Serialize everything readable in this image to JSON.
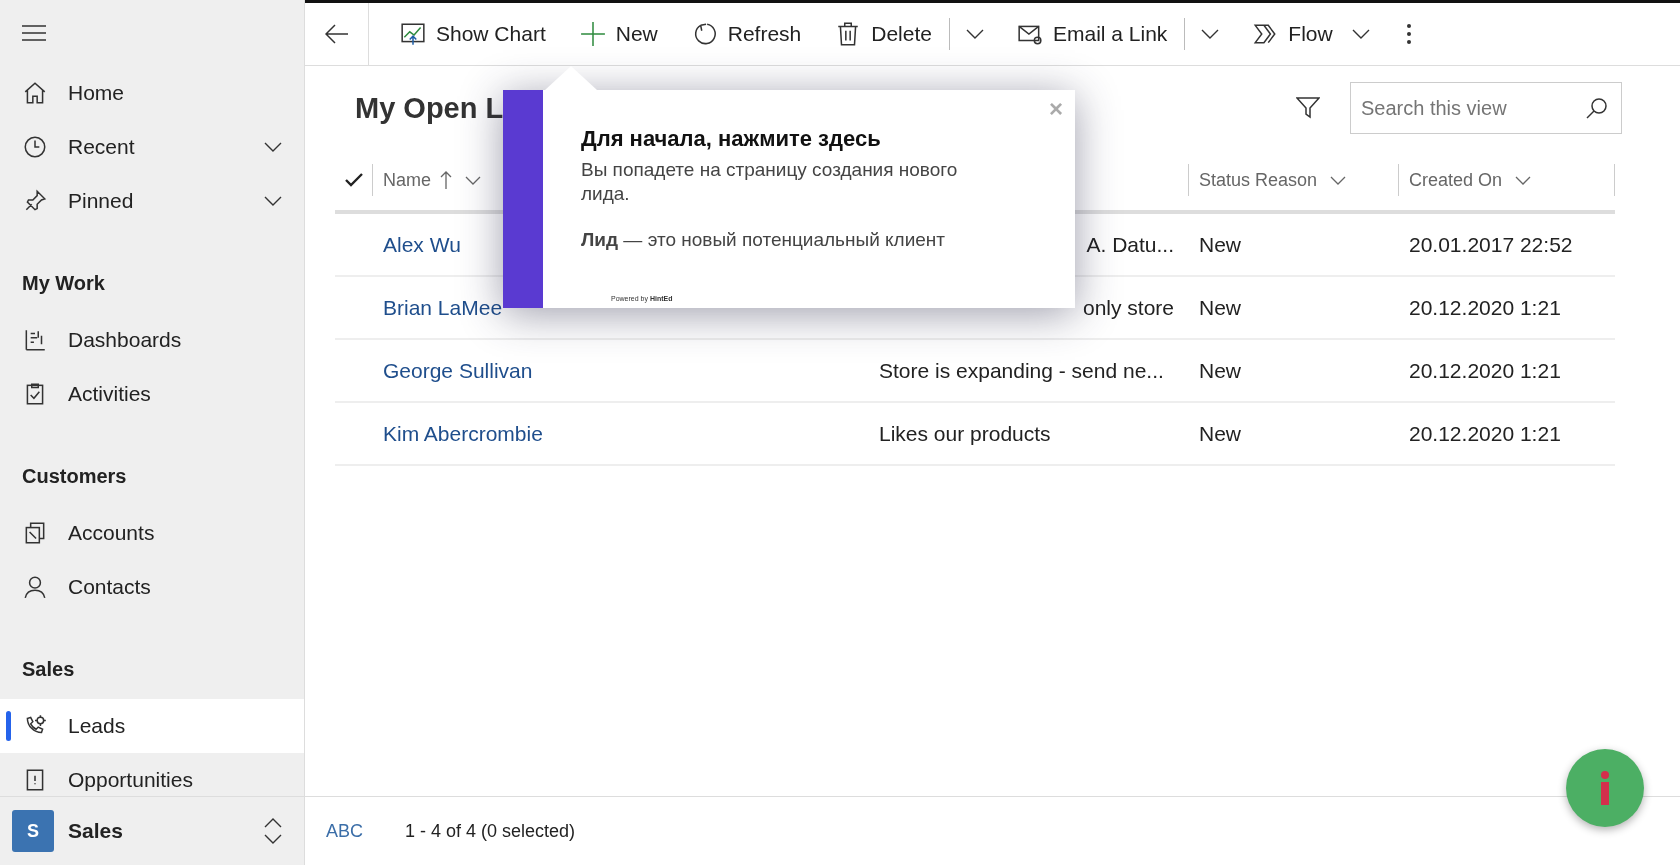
{
  "sidebar": {
    "top_items": [
      {
        "label": "Home",
        "has_menu": false,
        "selected": false
      },
      {
        "label": "Recent",
        "has_menu": true,
        "selected": false
      },
      {
        "label": "Pinned",
        "has_menu": true,
        "selected": false
      }
    ],
    "groups": [
      {
        "title": "My Work",
        "items": [
          {
            "label": "Dashboards",
            "selected": false
          },
          {
            "label": "Activities",
            "selected": false
          }
        ]
      },
      {
        "title": "Customers",
        "items": [
          {
            "label": "Accounts",
            "selected": false
          },
          {
            "label": "Contacts",
            "selected": false
          }
        ]
      },
      {
        "title": "Sales",
        "items": [
          {
            "label": "Leads",
            "selected": true
          },
          {
            "label": "Opportunities",
            "selected": false
          }
        ]
      }
    ],
    "area": {
      "initial": "S",
      "label": "Sales"
    }
  },
  "toolbar": [
    {
      "label": "Show Chart",
      "kind": "button"
    },
    {
      "label": "New",
      "kind": "button"
    },
    {
      "label": "Refresh",
      "kind": "button"
    },
    {
      "label": "Delete",
      "kind": "split"
    },
    {
      "label": "Email a Link",
      "kind": "split"
    },
    {
      "label": "Flow",
      "kind": "menu"
    }
  ],
  "view": {
    "title": "My Open L",
    "search": {
      "placeholder": "Search this view"
    }
  },
  "table": {
    "columns": [
      {
        "label": "Name",
        "sorted": true
      },
      {
        "label": "Status Reason",
        "sorted": false
      },
      {
        "label": "Created On",
        "sorted": false
      }
    ],
    "rows": [
      {
        "name": "Alex Wu",
        "topic": "A. Datu...",
        "topic_covered": true,
        "status": "New",
        "created": "20.01.2017 22:52"
      },
      {
        "name": "Brian LaMee",
        "topic": "only store",
        "topic_covered": true,
        "status": "New",
        "created": "20.12.2020 1:21"
      },
      {
        "name": "George Sullivan",
        "topic": "Store is expanding - send ne...",
        "topic_covered": false,
        "status": "New",
        "created": "20.12.2020 1:21"
      },
      {
        "name": "Kim Abercrombie",
        "topic": "Likes our products",
        "topic_covered": false,
        "status": "New",
        "created": "20.12.2020 1:21"
      }
    ]
  },
  "status_bar": {
    "jump": "ABC",
    "count": "1 - 4 of 4 (0 selected)"
  },
  "hint_popup": {
    "close": "×",
    "title": "Для начала, нажмите здесь",
    "body": "Вы попадете на страницу создания нового лида.",
    "note": "**Лид** — это новый потенциальный клиент",
    "powered": "Powered by **HintEd**"
  }
}
